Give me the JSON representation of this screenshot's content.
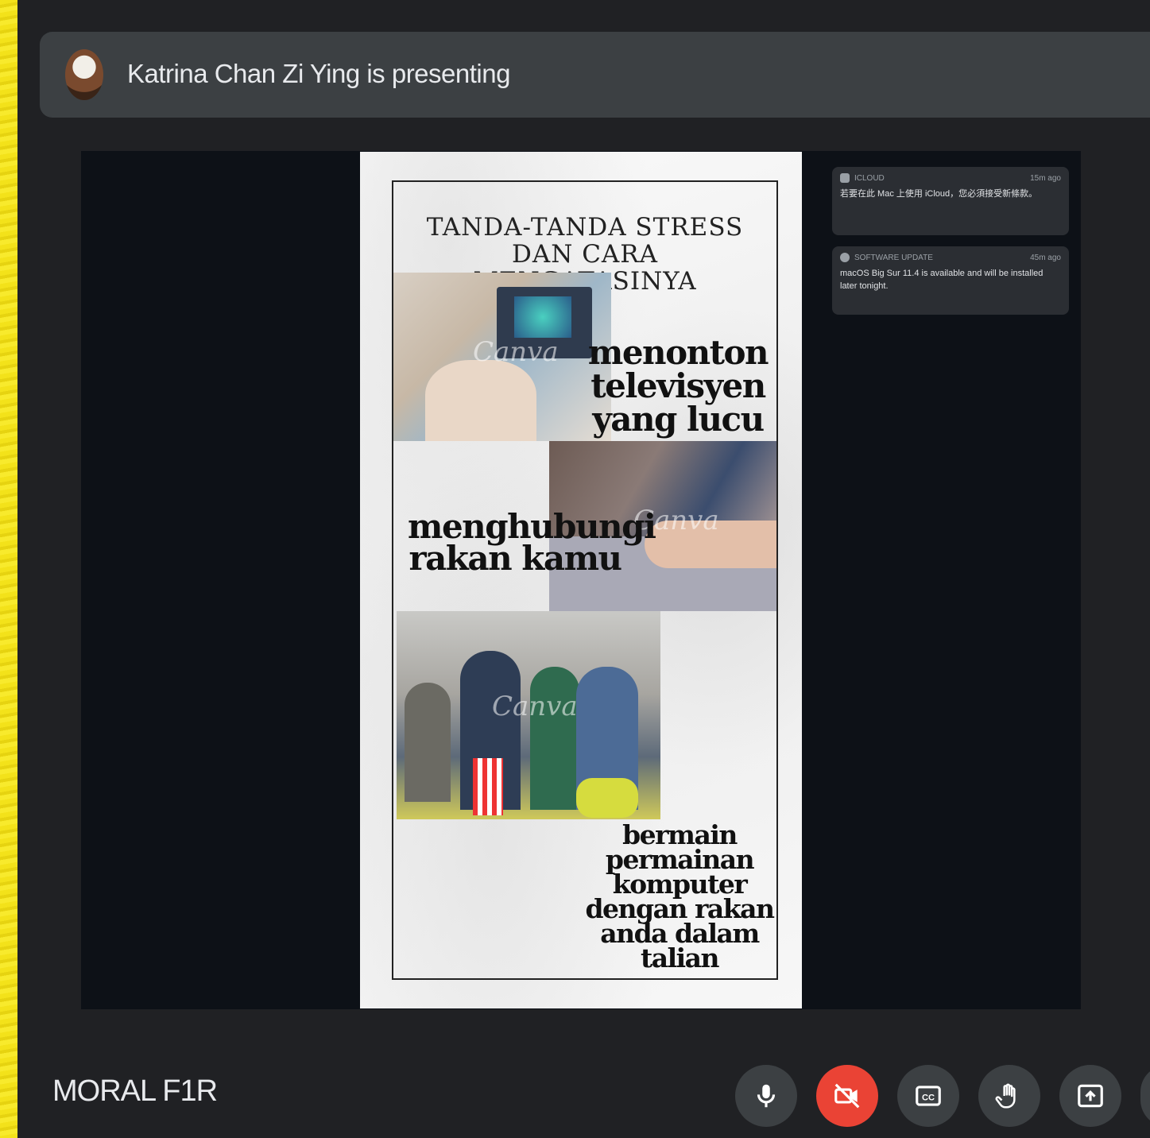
{
  "presenter": {
    "text": "Katrina Chan Zi Ying is presenting"
  },
  "slide": {
    "title": "TANDA-TANDA STRESS DAN CARA MENGATASINYA",
    "watermark": "Canva",
    "captions": [
      "menonton televisyen yang lucu",
      "menghubungi rakan kamu",
      "bermain permainan komputer dengan rakan anda dalam talian"
    ]
  },
  "notifications": [
    {
      "app": "ICLOUD",
      "time": "15m ago",
      "body": "若要在此 Mac 上使用 iCloud，您必須接受新條款。"
    },
    {
      "app": "SOFTWARE UPDATE",
      "time": "45m ago",
      "body": "macOS Big Sur 11.4 is available and will be installed later tonight."
    }
  ],
  "meeting": {
    "name": "MORAL F1R"
  },
  "controls": {
    "mic": "microphone-icon",
    "camera": "camera-off-icon",
    "captions": "captions-icon",
    "raise_hand": "hand-icon",
    "present": "present-screen-icon",
    "camera_off_color": "#ea4335"
  }
}
